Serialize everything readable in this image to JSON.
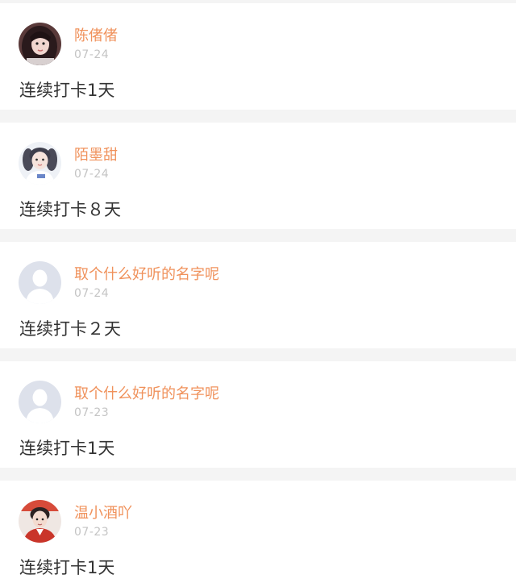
{
  "posts": [
    {
      "name": "陈偖偖",
      "date": "07-24",
      "content": "连续打卡1天",
      "avatar": "photo-girl-dark-hair-icon"
    },
    {
      "name": "陌墨甜",
      "date": "07-24",
      "content": "连续打卡８天",
      "avatar": "photo-girl-twin-tails-icon"
    },
    {
      "name": "取个什么好听的名字呢",
      "date": "07-24",
      "content": "连续打卡２天",
      "avatar": "default-user-icon"
    },
    {
      "name": "取个什么好听的名字呢",
      "date": "07-23",
      "content": "连续打卡1天",
      "avatar": "default-user-icon"
    },
    {
      "name": "温小酒吖",
      "date": "07-23",
      "content": "连续打卡1天",
      "avatar": "photo-boy-red-jacket-icon"
    }
  ],
  "colors": {
    "username": "#f0925c",
    "date": "#c4c4c4",
    "content": "#333333",
    "separator": "#f4f4f4",
    "card": "#ffffff"
  }
}
